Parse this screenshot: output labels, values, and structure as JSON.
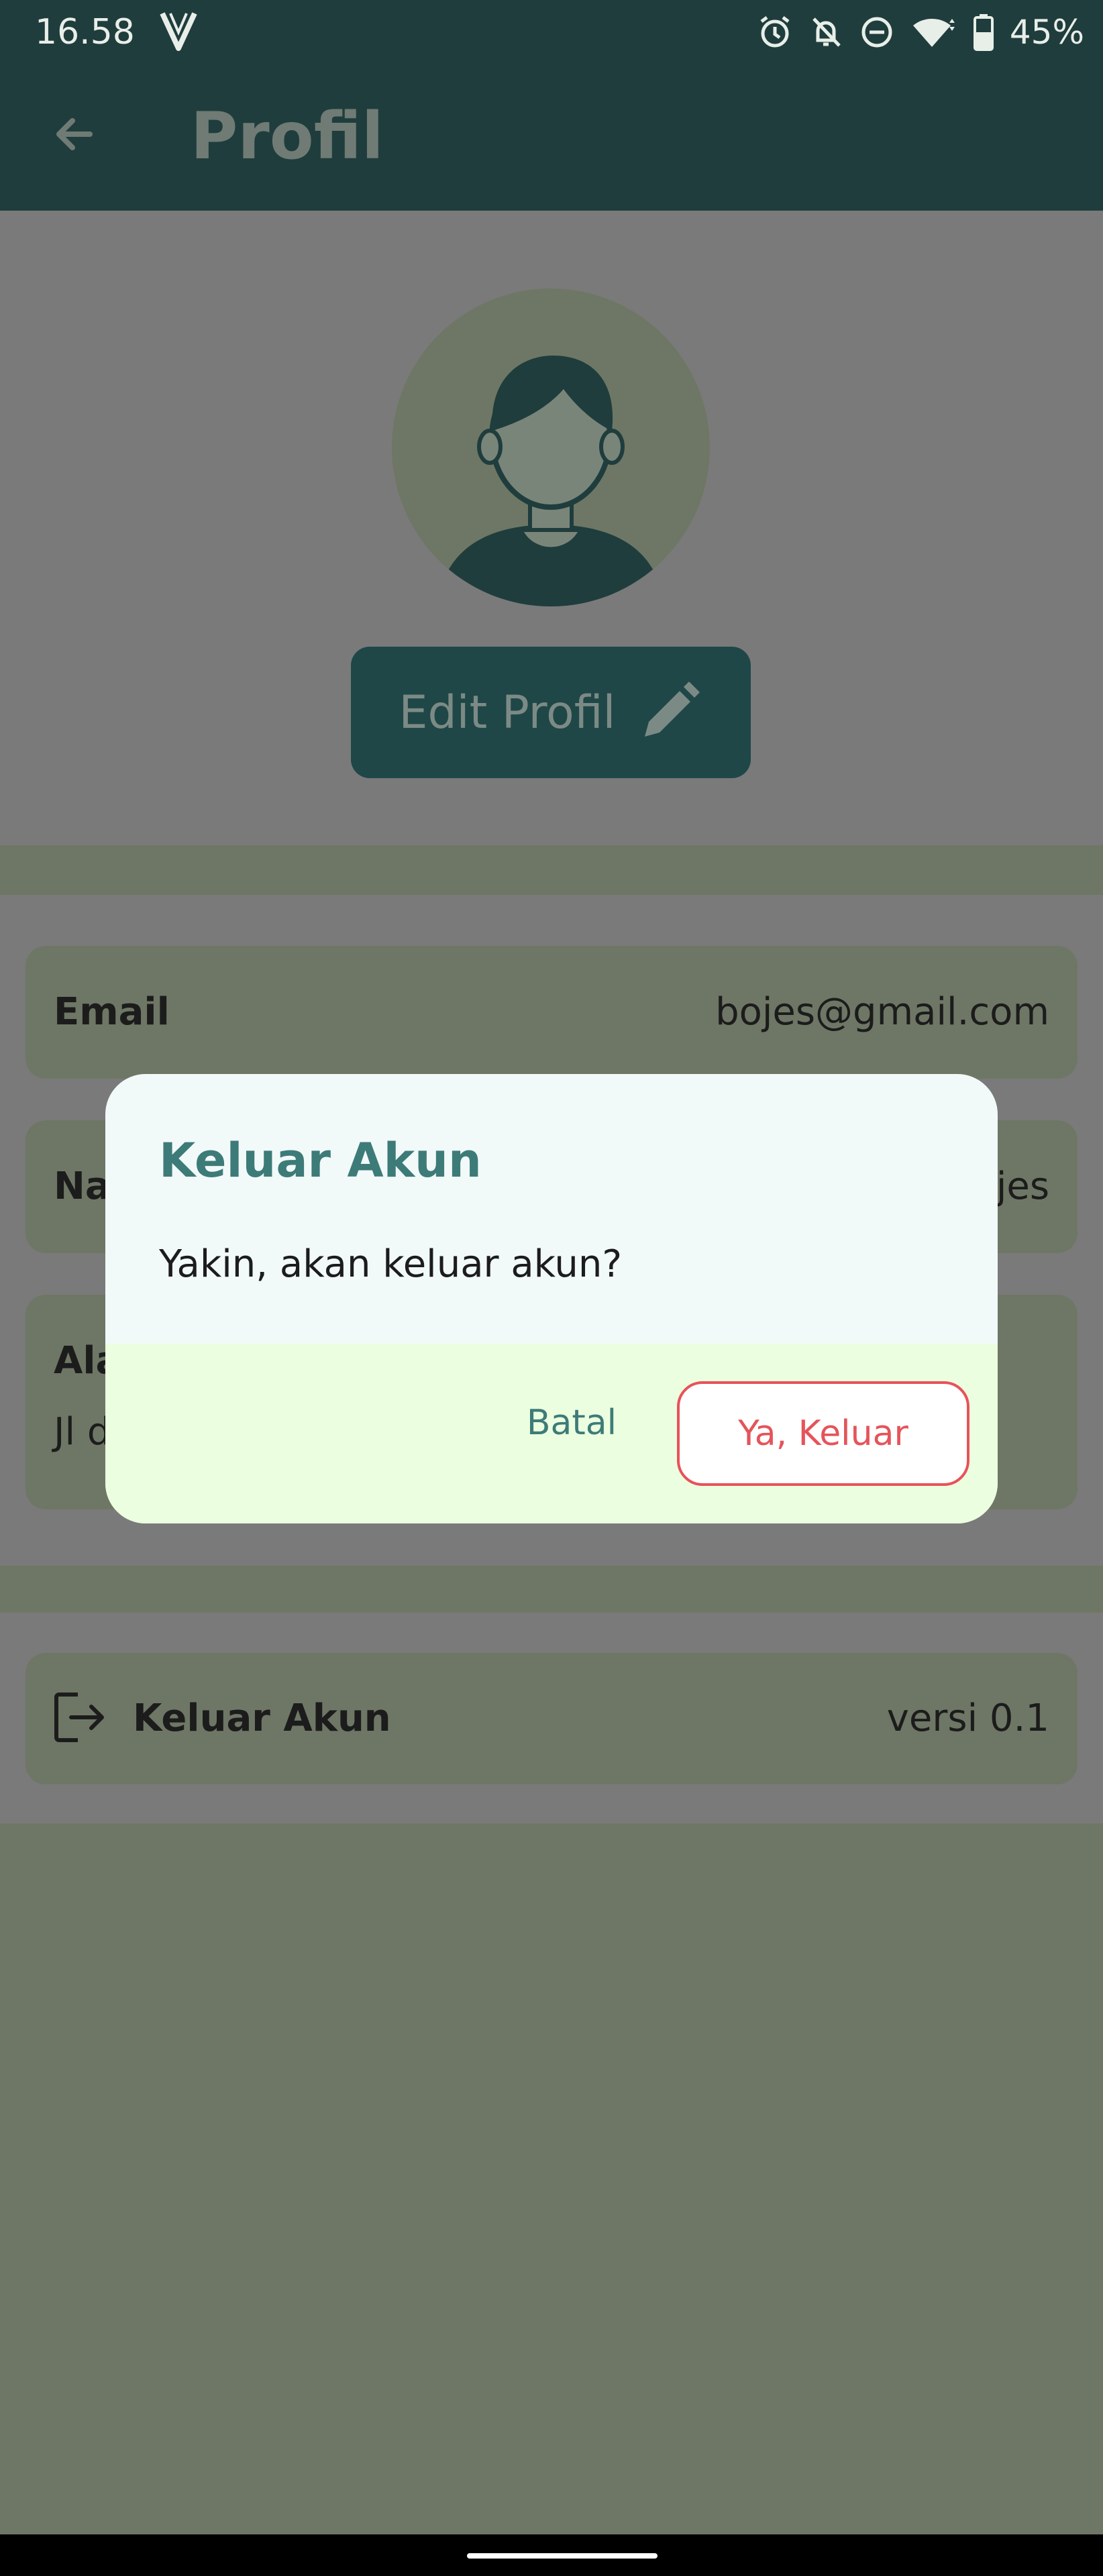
{
  "status_bar": {
    "time": "16.58",
    "battery": "45%"
  },
  "app_bar": {
    "title": "Profil"
  },
  "profile": {
    "edit_label": "Edit Profil"
  },
  "info": {
    "email_label": "Email",
    "email_value": "bojes@gmail.com",
    "nama_label_partial": "Na",
    "nama_value_partial": "jes",
    "alamat_label_partial": "Ala",
    "alamat_value_partial": "Jl d"
  },
  "logout_row": {
    "label": "Keluar Akun",
    "version": "versi 0.1"
  },
  "dialog": {
    "title": "Keluar Akun",
    "message": "Yakin, akan keluar akun?",
    "cancel": "Batal",
    "confirm": "Ya, Keluar"
  },
  "colors": {
    "app_bar": "#1f3d3d",
    "dialog_accent": "#3d7b78",
    "danger": "#e4545a",
    "dialog_footer": "#ecfee0"
  }
}
